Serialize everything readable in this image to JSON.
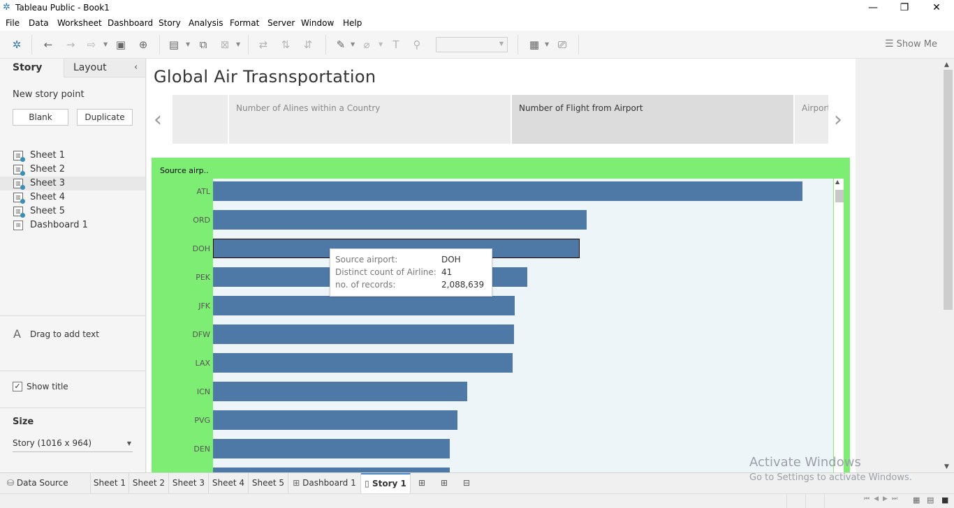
{
  "window": {
    "title": "Tableau Public - Book1"
  },
  "menu": [
    "File",
    "Data",
    "Worksheet",
    "Dashboard",
    "Story",
    "Analysis",
    "Format",
    "Server",
    "Window",
    "Help"
  ],
  "toolbar": {
    "show_me": "Show Me"
  },
  "sidebar": {
    "tabs": [
      "Story",
      "Layout"
    ],
    "new_story_point": "New story point",
    "blank_button": "Blank",
    "duplicate_button": "Duplicate",
    "sheets": [
      "Sheet 1",
      "Sheet 2",
      "Sheet 3",
      "Sheet 4",
      "Sheet 5"
    ],
    "dashboard": "Dashboard 1",
    "drag_text": "Drag to add text",
    "show_title": "Show title",
    "size_heading": "Size",
    "size_value": "Story (1016 x 964)"
  },
  "story": {
    "title": "Global Air Trasnsportation",
    "points": [
      "",
      "Number of Alines within a Country",
      "Number of Flight from Airport",
      "Airport"
    ],
    "active_point": 2
  },
  "dashboard": {
    "field_label": "Source airp.."
  },
  "chart_data": {
    "type": "bar",
    "orientation": "horizontal",
    "categories": [
      "ATL",
      "ORD",
      "DOH",
      "PEK",
      "JFK",
      "DFW",
      "LAX",
      "ICN",
      "PVG",
      "DEN"
    ],
    "values": [
      3360000,
      2130000,
      2088639,
      1790000,
      1720000,
      1715000,
      1708000,
      1450000,
      1395000,
      1350000
    ],
    "highlighted": "DOH",
    "bar_color": "#4e79a7",
    "background_color": "#7ded73"
  },
  "tooltip": {
    "rows": [
      {
        "key": "Source airport:",
        "value": "DOH"
      },
      {
        "key": "Distinct count of Airline:",
        "value": "41"
      },
      {
        "key": "no. of records:",
        "value": "2,088,639"
      }
    ]
  },
  "tabs": {
    "data_source": "Data Source",
    "sheets": [
      "Sheet 1",
      "Sheet 2",
      "Sheet 3",
      "Sheet 4",
      "Sheet 5"
    ],
    "dashboard": "Dashboard 1",
    "story": "Story 1"
  },
  "watermark": {
    "line1": "Activate Windows",
    "line2": "Go to Settings to activate Windows."
  }
}
